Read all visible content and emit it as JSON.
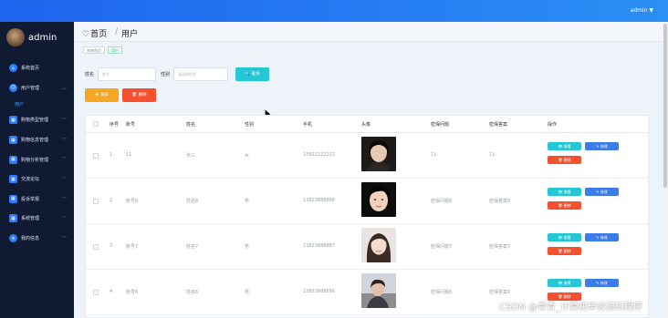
{
  "topbar": {
    "user_label": "admin ▼"
  },
  "sidebar": {
    "username": "admin",
    "items": [
      {
        "label": "系统首页",
        "icon": "home-icon"
      },
      {
        "label": "用户管理",
        "icon": "user-icon",
        "expanded": true
      },
      {
        "label": "用户",
        "sub": true
      },
      {
        "label": "购物类型管理",
        "icon": "grid-icon"
      },
      {
        "label": "购物信息管理",
        "icon": "grid-icon"
      },
      {
        "label": "购物分析管理",
        "icon": "grid-icon"
      },
      {
        "label": "交流论坛",
        "icon": "grid-icon"
      },
      {
        "label": "投诉举报",
        "icon": "grid-icon"
      },
      {
        "label": "系统管理",
        "icon": "grid-icon"
      },
      {
        "label": "我的信息",
        "icon": "doc-icon"
      }
    ]
  },
  "header": {
    "home": "首页",
    "separator": "/",
    "current": "用户"
  },
  "breadcrumb": {
    "items": [
      "系统首页",
      "用户"
    ]
  },
  "search": {
    "account_label": "姓名",
    "account_placeholder": "姓名",
    "gender_label": "性别",
    "gender_placeholder": "请选择性别",
    "search_button": "查询"
  },
  "toolbar": {
    "add": "添加",
    "delete": "删除"
  },
  "table": {
    "headers": [
      "序号",
      "账号",
      "姓名",
      "性别",
      "手机",
      "头像",
      "密保问题",
      "密保答案",
      "操作"
    ],
    "rows": [
      {
        "index": "1",
        "account": "11",
        "name": "张三",
        "gender": "女",
        "phone": "13922222222",
        "question": "11",
        "answer": "11"
      },
      {
        "index": "2",
        "account": "账号8",
        "name": "姓名8",
        "gender": "男",
        "phone": "13823888888",
        "question": "密保问题8",
        "answer": "密保答案8"
      },
      {
        "index": "3",
        "account": "账号7",
        "name": "姓名7",
        "gender": "男",
        "phone": "13823888887",
        "question": "密保问题7",
        "answer": "密保答案7"
      },
      {
        "index": "4",
        "account": "账号6",
        "name": "姓名6",
        "gender": "男",
        "phone": "13823888886",
        "question": "密保问题6",
        "answer": "密保答案6"
      }
    ],
    "actions": {
      "view": "查看",
      "edit": "修改",
      "delete": "删除"
    }
  },
  "watermark": "CSDN @青青_计算机毕设源码程序",
  "colors": {
    "topbar": "#1e64ee",
    "sidebar": "#101a33",
    "accent_cyan": "#26c7d4",
    "accent_orange": "#f5a623",
    "danger": "#f4502e",
    "edit_blue": "#3b7bea"
  }
}
